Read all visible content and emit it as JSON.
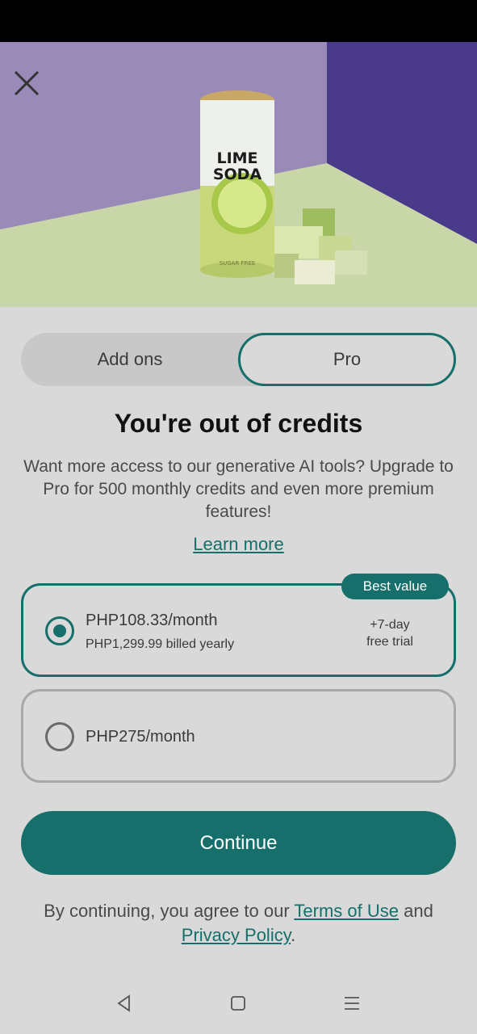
{
  "tabs": {
    "addons_label": "Add ons",
    "pro_label": "Pro",
    "selected": "Pro"
  },
  "title": "You're out of credits",
  "description": "Want more access to our generative AI tools? Upgrade to Pro for 500 monthly credits and even more premium features!",
  "learn_more": "Learn more",
  "hero": {
    "can_line1": "LIME",
    "can_line2": "SODA",
    "can_footer": "SUGAR FREE"
  },
  "plans": [
    {
      "price": "PHP108.33/month",
      "billing": "PHP1,299.99 billed yearly",
      "trial_line1": "+7-day",
      "trial_line2": "free trial",
      "badge": "Best value",
      "selected": true
    },
    {
      "price": "PHP275/month",
      "selected": false
    }
  ],
  "continue_label": "Continue",
  "legal": {
    "prefix": "By continuing, you agree to our ",
    "terms": "Terms of Use",
    "middle": " and",
    "privacy": "Privacy Policy",
    "suffix": "."
  },
  "colors": {
    "accent": "#166f6a",
    "background": "#d9d9d9",
    "hero_wall": "#9a8ab8",
    "hero_table": "#c9d6a8"
  },
  "icons": {
    "close": "close-icon",
    "back": "nav-back-icon",
    "home": "nav-home-icon",
    "menu": "nav-menu-icon"
  }
}
